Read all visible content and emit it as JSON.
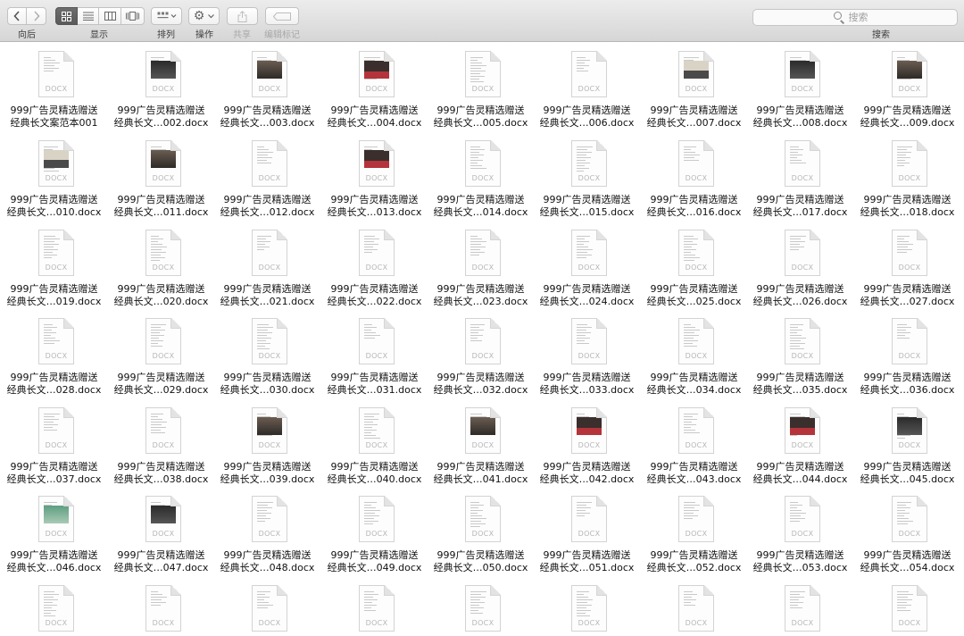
{
  "toolbar": {
    "back_label": "向后",
    "view_label": "显示",
    "arrange_label": "排列",
    "action_label": "操作",
    "share_label": "共享",
    "tags_label": "编辑标记",
    "search_label": "搜索",
    "search_placeholder": "搜索"
  },
  "icons": {
    "back": "chevron-left-icon",
    "forward": "chevron-right-icon",
    "view_icons": "grid-view-icon",
    "view_list": "list-view-icon",
    "view_columns": "column-view-icon",
    "view_cover": "cover-flow-icon",
    "arrange": "arrange-icon",
    "action": "gear-icon",
    "share": "share-icon",
    "tags": "tag-icon",
    "search": "search-icon"
  },
  "colors": {
    "selected_view": "#636363",
    "toolbar_bg": "#e0e0e0",
    "file_text": "#111111"
  },
  "file_ext": "DOCX",
  "files": [
    {
      "line1": "999广告灵精选赠送",
      "line2": "经典长文案范本001",
      "thumb": "text"
    },
    {
      "line1": "999广告灵精选赠送",
      "line2": "经典长文…002.docx",
      "thumb": "dark"
    },
    {
      "line1": "999广告灵精选赠送",
      "line2": "经典长文…003.docx",
      "thumb": "photo"
    },
    {
      "line1": "999广告灵精选赠送",
      "line2": "经典长文…004.docx",
      "thumb": "redphoto"
    },
    {
      "line1": "999广告灵精选赠送",
      "line2": "经典长文…005.docx",
      "thumb": "text"
    },
    {
      "line1": "999广告灵精选赠送",
      "line2": "经典长文…006.docx",
      "thumb": "text"
    },
    {
      "line1": "999广告灵精选赠送",
      "line2": "经典长文…007.docx",
      "thumb": "car"
    },
    {
      "line1": "999广告灵精选赠送",
      "line2": "经典长文…008.docx",
      "thumb": "dark"
    },
    {
      "line1": "999广告灵精选赠送",
      "line2": "经典长文…009.docx",
      "thumb": "photo"
    },
    {
      "line1": "999广告灵精选赠送",
      "line2": "经典长文…010.docx",
      "thumb": "car"
    },
    {
      "line1": "999广告灵精选赠送",
      "line2": "经典长文…011.docx",
      "thumb": "photo"
    },
    {
      "line1": "999广告灵精选赠送",
      "line2": "经典长文…012.docx",
      "thumb": "text"
    },
    {
      "line1": "999广告灵精选赠送",
      "line2": "经典长文…013.docx",
      "thumb": "redphoto"
    },
    {
      "line1": "999广告灵精选赠送",
      "line2": "经典长文…014.docx",
      "thumb": "text"
    },
    {
      "line1": "999广告灵精选赠送",
      "line2": "经典长文…015.docx",
      "thumb": "text"
    },
    {
      "line1": "999广告灵精选赠送",
      "line2": "经典长文…016.docx",
      "thumb": "text"
    },
    {
      "line1": "999广告灵精选赠送",
      "line2": "经典长文…017.docx",
      "thumb": "text"
    },
    {
      "line1": "999广告灵精选赠送",
      "line2": "经典长文…018.docx",
      "thumb": "text"
    },
    {
      "line1": "999广告灵精选赠送",
      "line2": "经典长文…019.docx",
      "thumb": "text"
    },
    {
      "line1": "999广告灵精选赠送",
      "line2": "经典长文…020.docx",
      "thumb": "text"
    },
    {
      "line1": "999广告灵精选赠送",
      "line2": "经典长文…021.docx",
      "thumb": "text"
    },
    {
      "line1": "999广告灵精选赠送",
      "line2": "经典长文…022.docx",
      "thumb": "text"
    },
    {
      "line1": "999广告灵精选赠送",
      "line2": "经典长文…023.docx",
      "thumb": "text"
    },
    {
      "line1": "999广告灵精选赠送",
      "line2": "经典长文…024.docx",
      "thumb": "text"
    },
    {
      "line1": "999广告灵精选赠送",
      "line2": "经典长文…025.docx",
      "thumb": "text"
    },
    {
      "line1": "999广告灵精选赠送",
      "line2": "经典长文…026.docx",
      "thumb": "text"
    },
    {
      "line1": "999广告灵精选赠送",
      "line2": "经典长文…027.docx",
      "thumb": "text"
    },
    {
      "line1": "999广告灵精选赠送",
      "line2": "经典长文…028.docx",
      "thumb": "text"
    },
    {
      "line1": "999广告灵精选赠送",
      "line2": "经典长文…029.docx",
      "thumb": "text"
    },
    {
      "line1": "999广告灵精选赠送",
      "line2": "经典长文…030.docx",
      "thumb": "text"
    },
    {
      "line1": "999广告灵精选赠送",
      "line2": "经典长文…031.docx",
      "thumb": "text"
    },
    {
      "line1": "999广告灵精选赠送",
      "line2": "经典长文…032.docx",
      "thumb": "text"
    },
    {
      "line1": "999广告灵精选赠送",
      "line2": "经典长文…033.docx",
      "thumb": "text"
    },
    {
      "line1": "999广告灵精选赠送",
      "line2": "经典长文…034.docx",
      "thumb": "text"
    },
    {
      "line1": "999广告灵精选赠送",
      "line2": "经典长文…035.docx",
      "thumb": "text"
    },
    {
      "line1": "999广告灵精选赠送",
      "line2": "经典长文…036.docx",
      "thumb": "text"
    },
    {
      "line1": "999广告灵精选赠送",
      "line2": "经典长文…037.docx",
      "thumb": "text"
    },
    {
      "line1": "999广告灵精选赠送",
      "line2": "经典长文…038.docx",
      "thumb": "text"
    },
    {
      "line1": "999广告灵精选赠送",
      "line2": "经典长文…039.docx",
      "thumb": "photo"
    },
    {
      "line1": "999广告灵精选赠送",
      "line2": "经典长文…040.docx",
      "thumb": "text"
    },
    {
      "line1": "999广告灵精选赠送",
      "line2": "经典长文…041.docx",
      "thumb": "photo"
    },
    {
      "line1": "999广告灵精选赠送",
      "line2": "经典长文…042.docx",
      "thumb": "redphoto"
    },
    {
      "line1": "999广告灵精选赠送",
      "line2": "经典长文…043.docx",
      "thumb": "text"
    },
    {
      "line1": "999广告灵精选赠送",
      "line2": "经典长文…044.docx",
      "thumb": "redphoto"
    },
    {
      "line1": "999广告灵精选赠送",
      "line2": "经典长文…045.docx",
      "thumb": "dark"
    },
    {
      "line1": "999广告灵精选赠送",
      "line2": "经典长文…046.docx",
      "thumb": "green"
    },
    {
      "line1": "999广告灵精选赠送",
      "line2": "经典长文…047.docx",
      "thumb": "dark"
    },
    {
      "line1": "999广告灵精选赠送",
      "line2": "经典长文…048.docx",
      "thumb": "text"
    },
    {
      "line1": "999广告灵精选赠送",
      "line2": "经典长文…049.docx",
      "thumb": "text"
    },
    {
      "line1": "999广告灵精选赠送",
      "line2": "经典长文…050.docx",
      "thumb": "text"
    },
    {
      "line1": "999广告灵精选赠送",
      "line2": "经典长文…051.docx",
      "thumb": "text"
    },
    {
      "line1": "999广告灵精选赠送",
      "line2": "经典长文…052.docx",
      "thumb": "text"
    },
    {
      "line1": "999广告灵精选赠送",
      "line2": "经典长文…053.docx",
      "thumb": "text"
    },
    {
      "line1": "999广告灵精选赠送",
      "line2": "经典长文…054.docx",
      "thumb": "text"
    },
    {
      "line1": "",
      "line2": "",
      "thumb": "text"
    },
    {
      "line1": "",
      "line2": "",
      "thumb": "text"
    },
    {
      "line1": "",
      "line2": "",
      "thumb": "text"
    },
    {
      "line1": "",
      "line2": "",
      "thumb": "text"
    },
    {
      "line1": "",
      "line2": "",
      "thumb": "text"
    },
    {
      "line1": "",
      "line2": "",
      "thumb": "text"
    },
    {
      "line1": "",
      "line2": "",
      "thumb": "text"
    },
    {
      "line1": "",
      "line2": "",
      "thumb": "text"
    },
    {
      "line1": "",
      "line2": "",
      "thumb": "text"
    }
  ]
}
